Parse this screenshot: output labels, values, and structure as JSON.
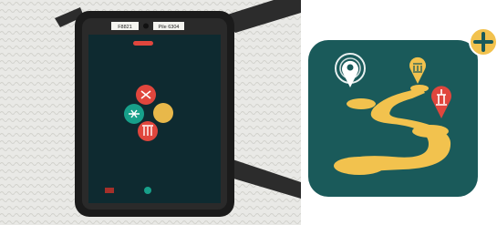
{
  "tablet_photo": {
    "tape_label_left": "F8821",
    "tape_label_right": "Pile 6304",
    "background_color": "#0e2a30",
    "menu_colors": {
      "top": "#e0463d",
      "left": "#17a08a",
      "right": "#e8b84a",
      "bottom": "#e0463d",
      "top_bar": "#e0463d"
    },
    "bottom_left_icon": "exit-icon",
    "bottom_center_icon": "home-icon"
  },
  "app_icon": {
    "background_color": "#1a5a5a",
    "path_color": "#f2c24e",
    "plus_badge_color": "#f2c24e",
    "pins": [
      "location-pin-icon",
      "museum-pin-icon",
      "monument-pin-icon"
    ]
  }
}
